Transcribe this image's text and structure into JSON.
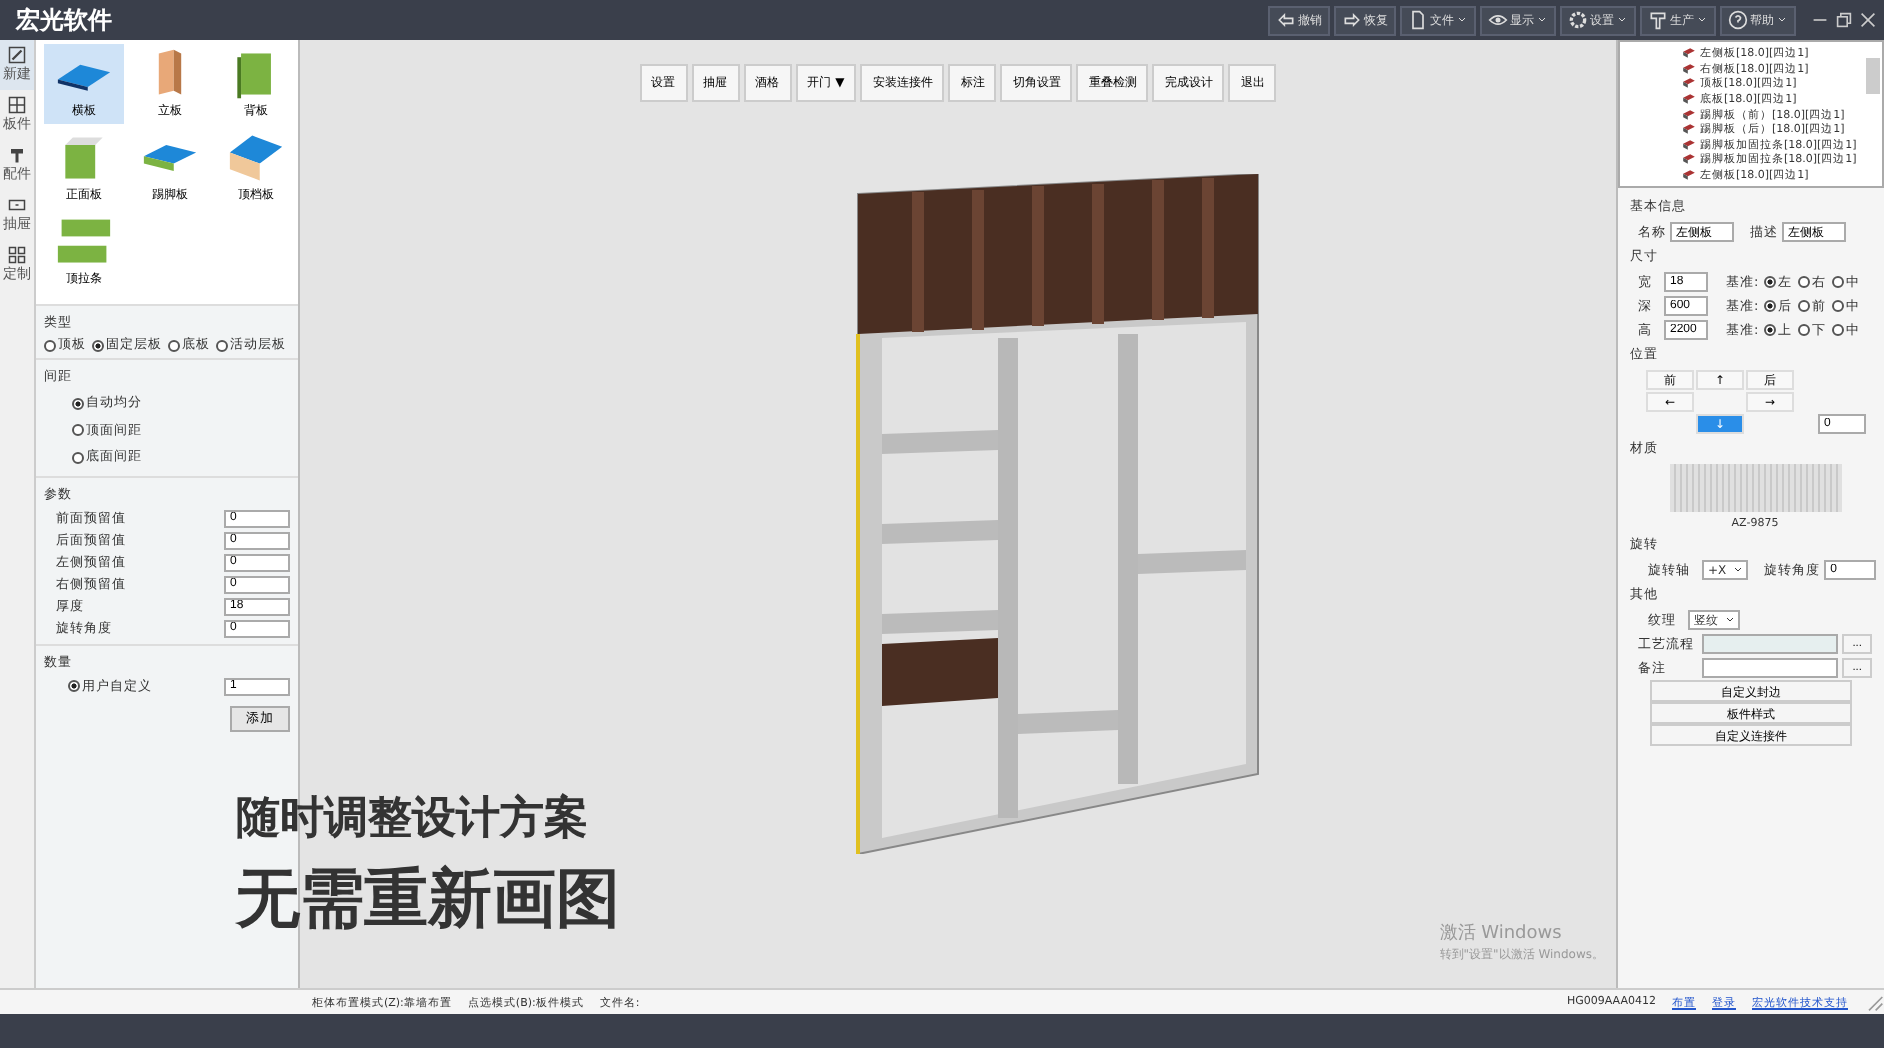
{
  "app": {
    "title": "宏光软件"
  },
  "top_actions": [
    {
      "label": "撤销",
      "kind": "undo",
      "dropdown": false
    },
    {
      "label": "恢复",
      "kind": "redo",
      "dropdown": false
    },
    {
      "label": "文件",
      "kind": "file",
      "dropdown": true
    },
    {
      "label": "显示",
      "kind": "eye",
      "dropdown": true
    },
    {
      "label": "设置",
      "kind": "gear",
      "dropdown": true
    },
    {
      "label": "生产",
      "kind": "tool",
      "dropdown": true
    },
    {
      "label": "帮助",
      "kind": "help",
      "dropdown": true
    }
  ],
  "side_tabs": [
    {
      "label": "新建",
      "kind": "pen",
      "selected": true
    },
    {
      "label": "板件",
      "kind": "grid",
      "selected": false
    },
    {
      "label": "配件",
      "kind": "hammer",
      "selected": false
    },
    {
      "label": "抽屉",
      "kind": "drawer",
      "selected": false
    },
    {
      "label": "定制",
      "kind": "blocks",
      "selected": false
    }
  ],
  "board_types": [
    {
      "label": "横板",
      "kind": "flat",
      "selected": true
    },
    {
      "label": "立板",
      "kind": "upright",
      "selected": false
    },
    {
      "label": "背板",
      "kind": "back",
      "selected": false
    },
    {
      "label": "正面板",
      "kind": "front",
      "selected": false
    },
    {
      "label": "踢脚板",
      "kind": "kick",
      "selected": false
    },
    {
      "label": "顶档板",
      "kind": "top",
      "selected": false
    },
    {
      "label": "顶拉条",
      "kind": "strip",
      "selected": false
    }
  ],
  "type_section": {
    "title": "类型",
    "options": [
      {
        "label": "顶板",
        "selected": false
      },
      {
        "label": "固定层板",
        "selected": true
      },
      {
        "label": "底板",
        "selected": false
      },
      {
        "label": "活动层板",
        "selected": false
      }
    ]
  },
  "spacing_section": {
    "title": "间距",
    "options": [
      {
        "label": "自动均分",
        "selected": true
      },
      {
        "label": "顶面间距",
        "selected": false
      },
      {
        "label": "底面间距",
        "selected": false
      }
    ]
  },
  "params_section": {
    "title": "参数",
    "fields": [
      {
        "label": "前面预留值",
        "value": "0"
      },
      {
        "label": "后面预留值",
        "value": "0"
      },
      {
        "label": "左侧预留值",
        "value": "0"
      },
      {
        "label": "右侧预留值",
        "value": "0"
      },
      {
        "label": "厚度",
        "value": "18"
      },
      {
        "label": "旋转角度",
        "value": "0"
      }
    ]
  },
  "count_section": {
    "title": "数量",
    "option": {
      "label": "用户自定义",
      "selected": true
    },
    "value": "1",
    "button": "添加"
  },
  "toolbar": [
    {
      "label": "设置"
    },
    {
      "label": "抽屉"
    },
    {
      "label": "酒格"
    },
    {
      "label": "开门 ▼"
    },
    {
      "label": "安装连接件"
    },
    {
      "label": "标注"
    },
    {
      "label": "切角设置"
    },
    {
      "label": "重叠检测"
    },
    {
      "label": "完成设计"
    },
    {
      "label": "退出"
    }
  ],
  "overlay_text": [
    "随时调整设计方案",
    "无需重新画图"
  ],
  "activation": {
    "title": "激活 Windows",
    "hint": "转到\"设置\"以激活 Windows。"
  },
  "tree": [
    "左侧板[18.0][四边1]",
    "右侧板[18.0][四边1]",
    "顶板[18.0][四边1]",
    "底板[18.0][四边1]",
    "踢脚板（前）[18.0][四边1]",
    "踢脚板（后）[18.0][四边1]",
    "踢脚板加固拉条[18.0][四边1]",
    "踢脚板加固拉条[18.0][四边1]",
    "左侧板[18.0][四边1]"
  ],
  "props": {
    "basic_title": "基本信息",
    "name_label": "名称",
    "name_value": "左侧板",
    "desc_label": "描述",
    "desc_value": "左侧板",
    "size_title": "尺寸",
    "sizes": [
      {
        "label": "宽",
        "value": "18",
        "base_label": "基准:",
        "options": [
          {
            "label": "左",
            "selected": true
          },
          {
            "label": "右",
            "selected": false
          },
          {
            "label": "中",
            "selected": false
          }
        ]
      },
      {
        "label": "深",
        "value": "600",
        "base_label": "基准:",
        "options": [
          {
            "label": "后",
            "selected": true
          },
          {
            "label": "前",
            "selected": false
          },
          {
            "label": "中",
            "selected": false
          }
        ]
      },
      {
        "label": "高",
        "value": "2200",
        "base_label": "基准:",
        "options": [
          {
            "label": "上",
            "selected": true
          },
          {
            "label": "下",
            "selected": false
          },
          {
            "label": "中",
            "selected": false
          }
        ]
      }
    ],
    "position_title": "位置",
    "position_buttons": [
      {
        "kind": "button",
        "label": "前",
        "selected": false
      },
      {
        "kind": "button",
        "label": "↑",
        "selected": false
      },
      {
        "kind": "button",
        "label": "后",
        "selected": false
      },
      {
        "kind": "button",
        "label": "←",
        "selected": false
      },
      {
        "kind": "gap"
      },
      {
        "kind": "button",
        "label": "→",
        "selected": false
      },
      {
        "kind": "gap"
      },
      {
        "kind": "button",
        "label": "↓",
        "selected": true
      },
      {
        "kind": "gap"
      }
    ],
    "position_value": "0",
    "material_title": "材质",
    "material_code": "AZ-9875",
    "rotate_title": "旋转",
    "axis_label": "旋转轴",
    "axis_value": "+X",
    "angle_label": "旋转角度",
    "angle_value": "0",
    "other_title": "其他",
    "grain_label": "纹理",
    "grain_value": "竖纹",
    "process_label": "工艺流程",
    "note_label": "备注",
    "more": "...",
    "buttons": [
      "自定义封边",
      "板件样式",
      "自定义连接件"
    ]
  },
  "status_bar": {
    "left": [
      "柜体布置模式(Z):靠墙布置",
      "点选模式(B):板件模式",
      "文件名:"
    ],
    "code": "HG009AAA0412",
    "links": [
      "布置",
      "登录",
      "宏光软件技术支持"
    ]
  }
}
